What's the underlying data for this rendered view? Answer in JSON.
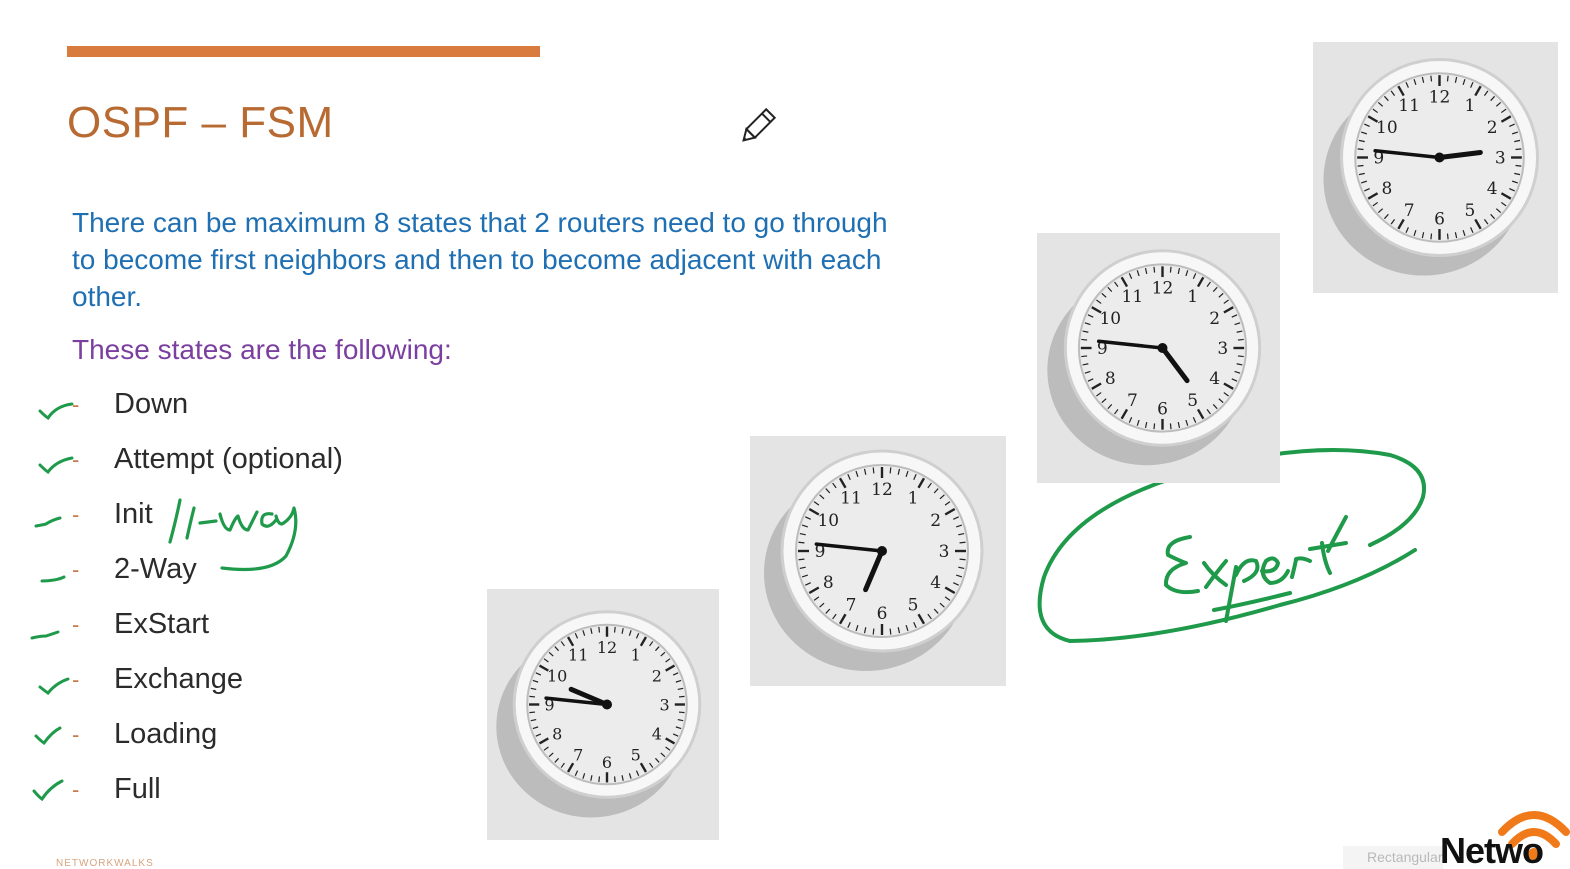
{
  "slide": {
    "title": "OSPF – FSM",
    "intro": "There can be maximum 8 states that 2 routers need to go through to become first neighbors and then to become adjacent with each other.",
    "lead": "These states are the following:",
    "states": [
      {
        "label": "Down",
        "checked": true
      },
      {
        "label": "Attempt (optional)",
        "checked": true
      },
      {
        "label": "Init",
        "checked": true
      },
      {
        "label": "2-Way",
        "checked": true
      },
      {
        "label": "ExStart",
        "checked": true
      },
      {
        "label": "Exchange",
        "checked": true
      },
      {
        "label": "Loading",
        "checked": true
      },
      {
        "label": "Full",
        "checked": true
      }
    ],
    "bullet_marker": "-",
    "handwriting": {
      "init_note": "1-way",
      "expert_note": "Expert",
      "ink_color": "#1f9a4a"
    },
    "clocks": [
      {
        "name": "clock-1",
        "hour": 9,
        "minute": 46
      },
      {
        "name": "clock-2",
        "hour": 6,
        "minute": 46
      },
      {
        "name": "clock-3",
        "hour": 4,
        "minute": 46
      },
      {
        "name": "clock-4",
        "hour": 2,
        "minute": 46
      }
    ],
    "clock_numerals": [
      "12",
      "1",
      "2",
      "3",
      "4",
      "5",
      "6",
      "7",
      "8",
      "9",
      "10",
      "11"
    ],
    "colors": {
      "accent": "#d97a3e",
      "title": "#b86a33",
      "intro": "#1f6fb3",
      "lead": "#7b3fa0",
      "ink": "#1f9a4a",
      "logo_orange": "#f07a1a"
    },
    "icons": [
      "pencil-cursor-icon",
      "checkmark-icon",
      "wifi-arcs-icon"
    ]
  },
  "brand": {
    "logo_text": "Netwo"
  },
  "tooltip": {
    "text": "Rectangular"
  },
  "footer": {
    "text": "NETWORKWALKS"
  }
}
